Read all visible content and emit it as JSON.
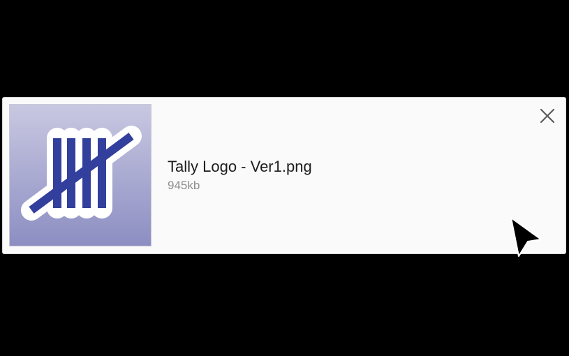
{
  "file": {
    "name": "Tally Logo - Ver1.png",
    "size": "945kb",
    "thumbnail_icon": "tally-marks-logo"
  },
  "actions": {
    "close_icon": "close-icon"
  },
  "colors": {
    "background": "#000000",
    "card": "#fafafa",
    "thumbnail_top": "#c9c8e2",
    "thumbnail_bottom": "#8c8ec2",
    "logo_blue": "#333f9c",
    "file_name": "#1c1c1c",
    "file_size": "#8e8e8e"
  },
  "cursor": {
    "icon": "mouse-pointer-icon"
  }
}
